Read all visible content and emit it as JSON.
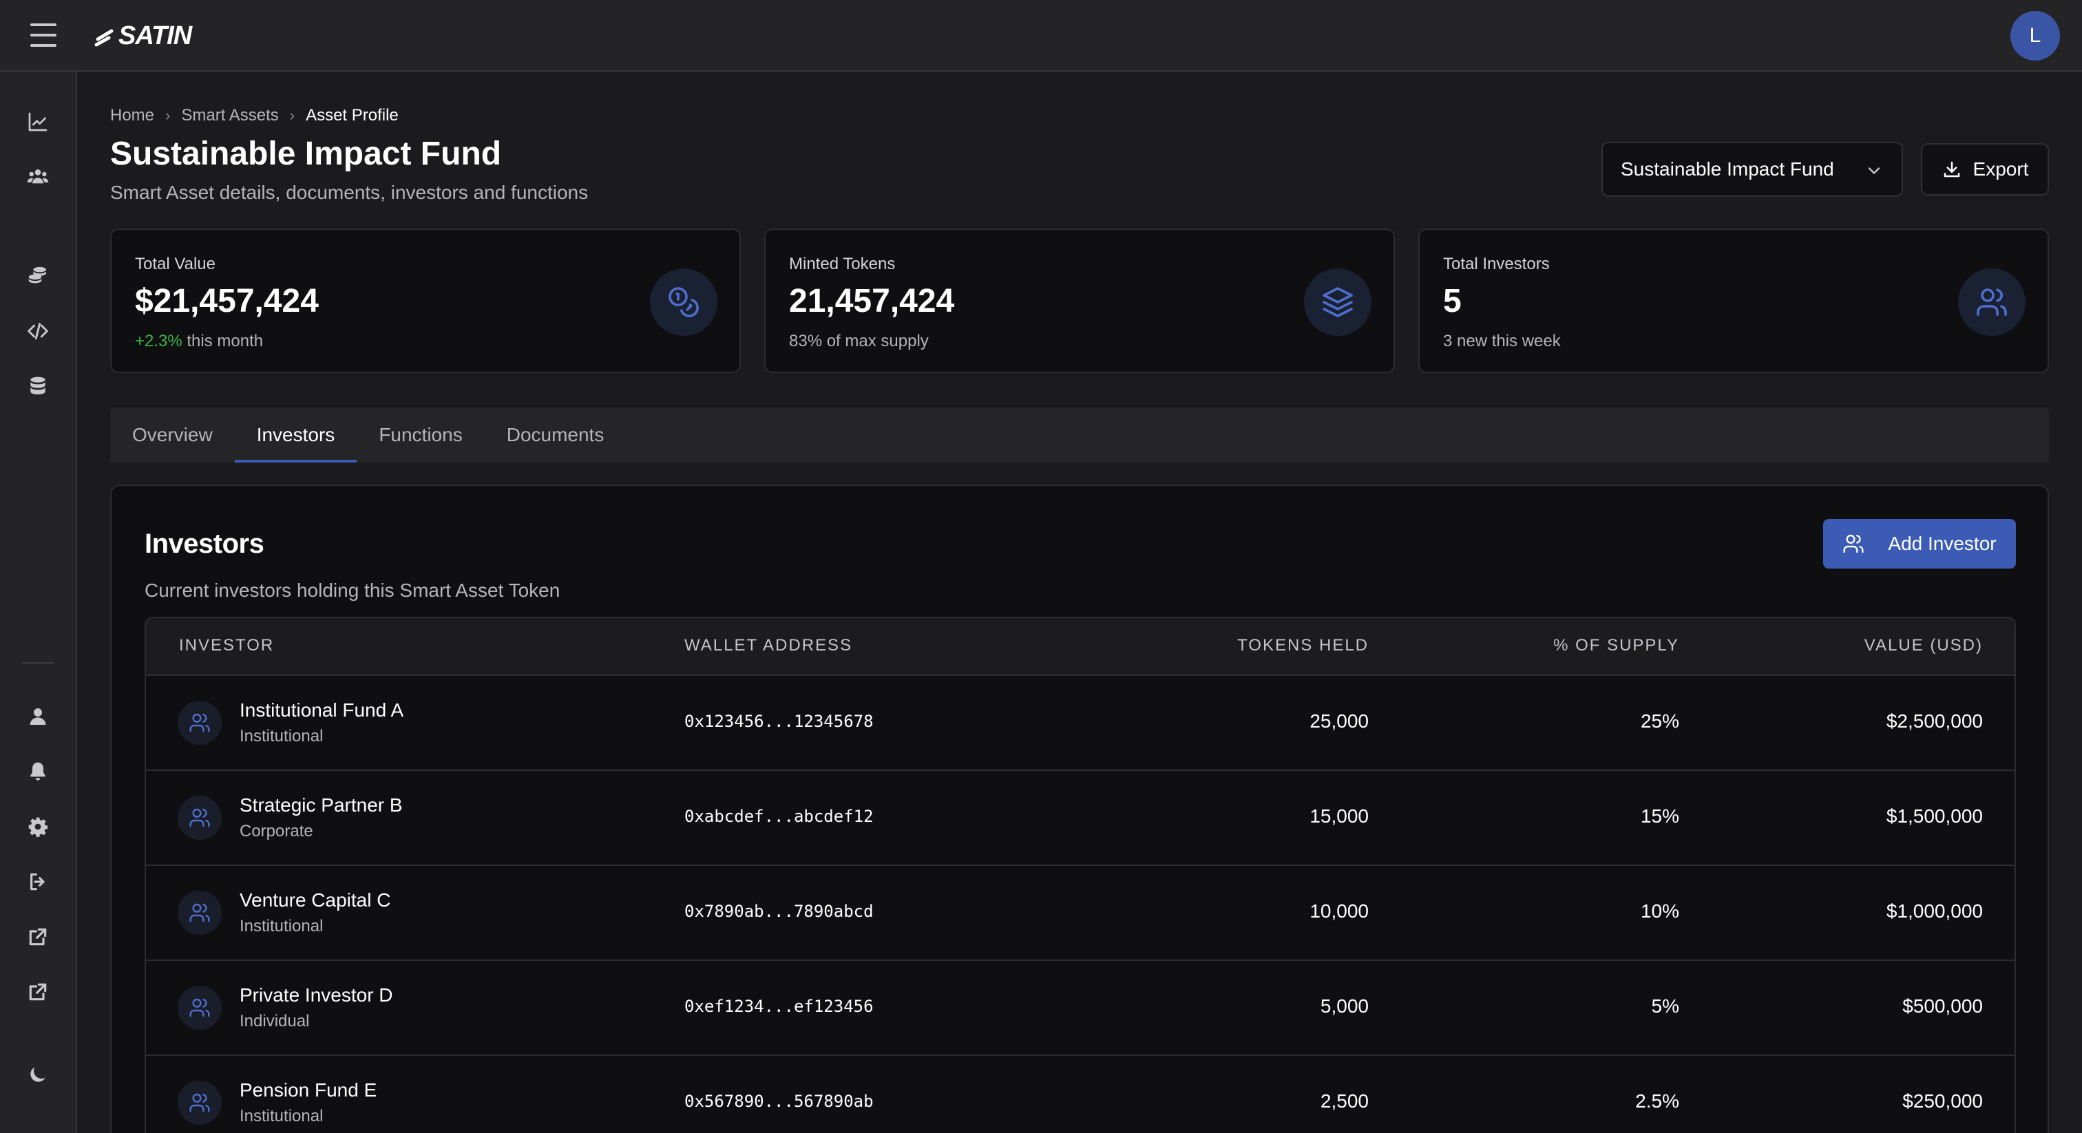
{
  "app": {
    "brand": "SATIN",
    "user_initial": "L"
  },
  "sidebar": {
    "items": [
      {
        "icon": "chart-line-icon"
      },
      {
        "icon": "users-icon"
      },
      {
        "icon": "coins-icon"
      },
      {
        "icon": "code-icon"
      },
      {
        "icon": "database-icon"
      },
      {
        "icon": "user-icon"
      },
      {
        "icon": "bell-icon"
      },
      {
        "icon": "gear-icon"
      },
      {
        "icon": "logout-icon"
      },
      {
        "icon": "external-link-icon"
      },
      {
        "icon": "external-link-icon"
      },
      {
        "icon": "moon-icon"
      }
    ]
  },
  "breadcrumb": {
    "home": "Home",
    "smart_assets": "Smart Assets",
    "current": "Asset Profile"
  },
  "header": {
    "title": "Sustainable Impact Fund",
    "subtitle": "Smart Asset details, documents, investors and functions",
    "asset_selected": "Sustainable Impact Fund",
    "export_label": "Export"
  },
  "stats": {
    "total_value": {
      "label": "Total Value",
      "value": "$21,457,424",
      "change": "+2.3%",
      "change_suffix": " this month"
    },
    "minted_tokens": {
      "label": "Minted Tokens",
      "value": "21,457,424",
      "sub": "83% of max supply"
    },
    "total_investors": {
      "label": "Total Investors",
      "value": "5",
      "sub": "3 new this week"
    }
  },
  "tabs": [
    "Overview",
    "Investors",
    "Functions",
    "Documents"
  ],
  "active_tab": "Investors",
  "investors": {
    "title": "Investors",
    "subtitle": "Current investors holding this Smart Asset Token",
    "add_label": "Add Investor",
    "columns": {
      "investor": "Investor",
      "wallet": "Wallet Address",
      "tokens": "Tokens Held",
      "supply": "% of Supply",
      "value": "Value (USD)"
    },
    "rows": [
      {
        "name": "Institutional Fund A",
        "type": "Institutional",
        "wallet": "0x123456...12345678",
        "tokens": "25,000",
        "supply": "25%",
        "value": "$2,500,000"
      },
      {
        "name": "Strategic Partner B",
        "type": "Corporate",
        "wallet": "0xabcdef...abcdef12",
        "tokens": "15,000",
        "supply": "15%",
        "value": "$1,500,000"
      },
      {
        "name": "Venture Capital C",
        "type": "Institutional",
        "wallet": "0x7890ab...7890abcd",
        "tokens": "10,000",
        "supply": "10%",
        "value": "$1,000,000"
      },
      {
        "name": "Private Investor D",
        "type": "Individual",
        "wallet": "0xef1234...ef123456",
        "tokens": "5,000",
        "supply": "5%",
        "value": "$500,000"
      },
      {
        "name": "Pension Fund E",
        "type": "Institutional",
        "wallet": "0x567890...567890ab",
        "tokens": "2,500",
        "supply": "2.5%",
        "value": "$250,000"
      }
    ]
  },
  "colors": {
    "accent": "#3b5bb5",
    "positive": "#3bb54a",
    "background": "#1b1b1d",
    "card": "#0f0f11"
  }
}
